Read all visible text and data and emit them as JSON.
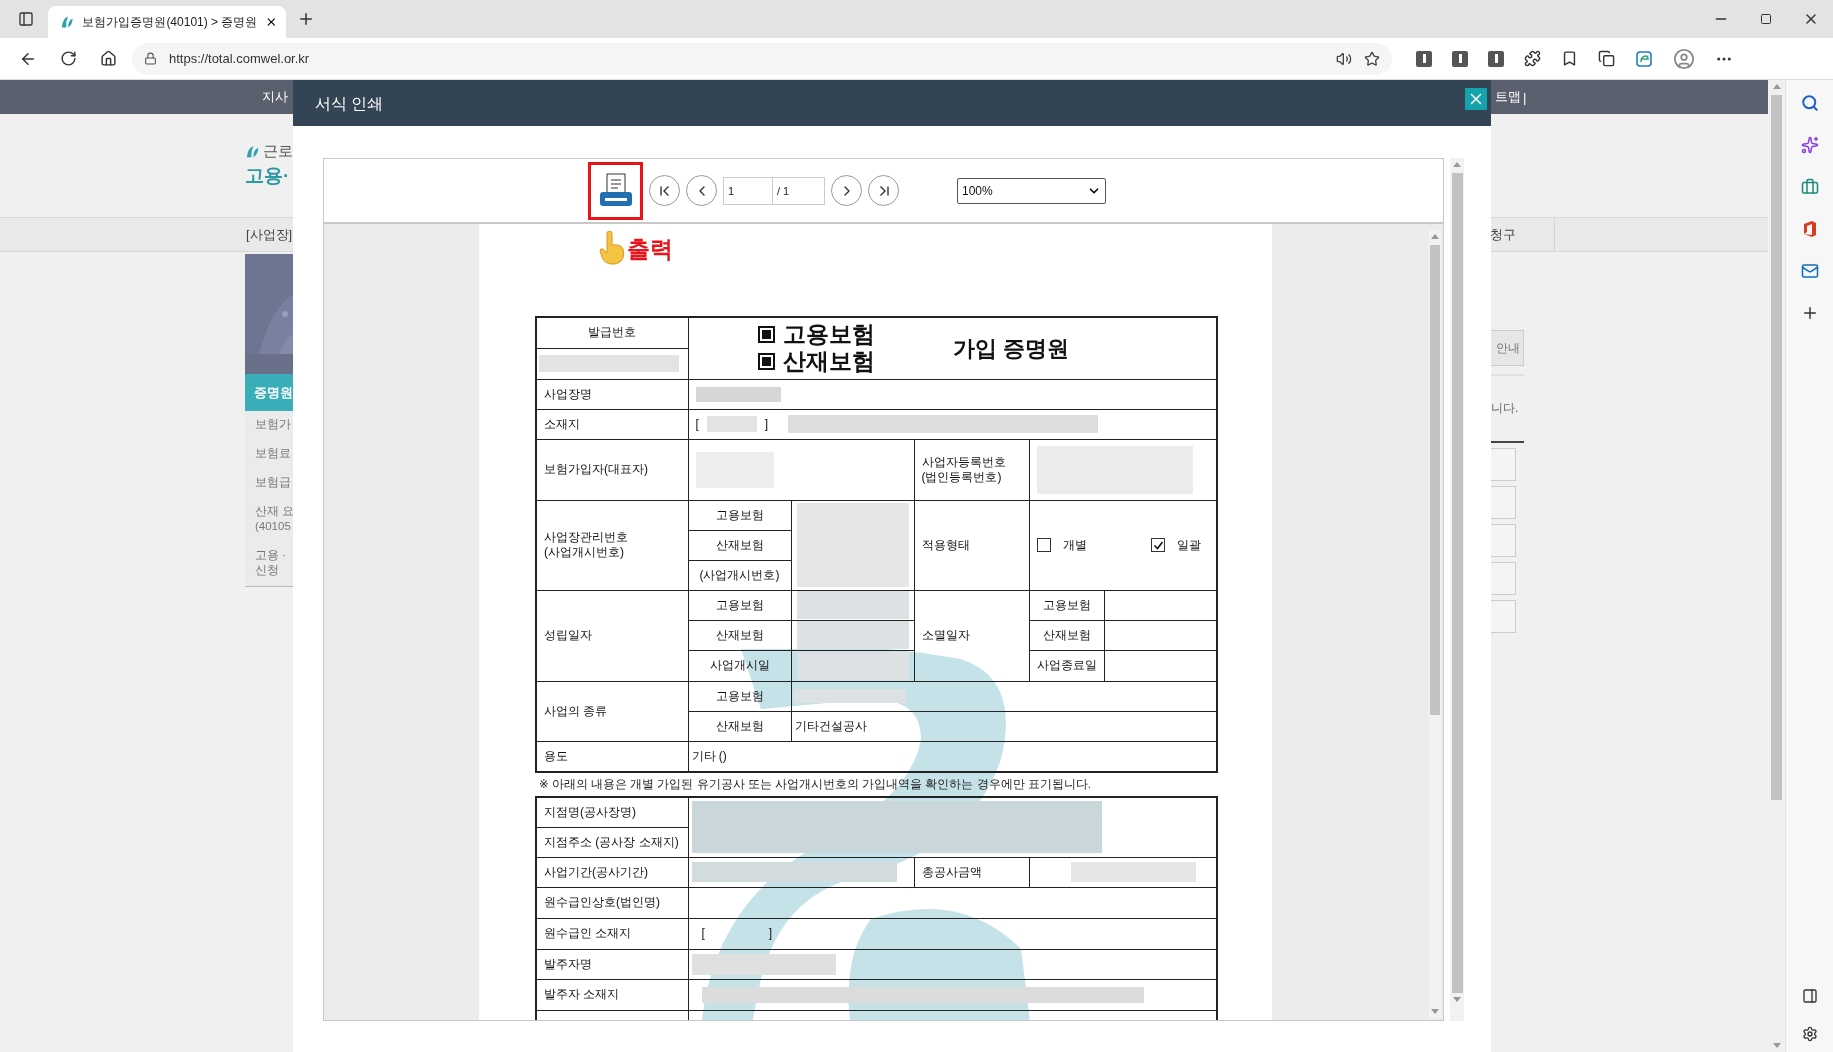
{
  "browser": {
    "tab_title": "보험가입증명원(40101) > 증명원",
    "url": "https://total.comwel.or.kr"
  },
  "site": {
    "nav_left": "지사",
    "nav_right": "트맵",
    "nav_divider": "|",
    "logo_lines": [
      "근로",
      "고용·"
    ],
    "breadcrumb": "[사업장]",
    "breadcrumb_right": "청구",
    "side_menu": {
      "title": "증명원",
      "items": [
        {
          "lines": [
            "보험가"
          ]
        },
        {
          "lines": [
            "보험료"
          ]
        },
        {
          "lines": [
            "보험급"
          ]
        },
        {
          "lines": [
            "산재 요",
            "(40105"
          ]
        },
        {
          "lines": [
            "고용 ·",
            "신청"
          ]
        }
      ]
    },
    "guide_button": "안내",
    "notice": "니다."
  },
  "modal": {
    "title": "서식 인쇄",
    "toolbar": {
      "page": "1",
      "page_total": "/ 1",
      "zoom": "100%"
    },
    "callout": "출력",
    "document": {
      "issue_label": "발급번호",
      "insurance_types": [
        {
          "label": "고용보험",
          "checked": true
        },
        {
          "label": "산재보험",
          "checked": true
        }
      ],
      "title": "가입 증명원",
      "business_name_label": "사업장명",
      "address_label": "소재지",
      "address_brackets": [
        "[",
        "]"
      ],
      "insured_label": "보험가입자(대표자)",
      "registration_label": [
        "사업자등록번호",
        "(법인등록번호)"
      ],
      "management_label": [
        "사업장관리번호",
        "(사업개시번호)"
      ],
      "management_sub": [
        "고용보험",
        "산재보험",
        "(사업개시번호)"
      ],
      "apply_type_label": "적용형태",
      "apply_options": [
        {
          "label": "개별",
          "checked": false
        },
        {
          "label": "일괄",
          "checked": true
        }
      ],
      "established_label": "성립일자",
      "established_sub": [
        "고용보험",
        "산재보험",
        "사업개시일"
      ],
      "closed_label": "소멸일자",
      "closed_sub": [
        "고용보험",
        "산재보험",
        "사업종료일"
      ],
      "business_type_label": "사업의 종류",
      "business_type_sub": [
        "고용보험",
        "산재보험"
      ],
      "business_type_value": "기타건설공사",
      "usage_label": "용도",
      "usage_value": "기타 ()",
      "note": "※ 아래의 내용은 개별 가입된 유기공사 또는 사업개시번호의 가입내역을 확인하는 경우에만 표기됩니다.",
      "branch_name_label": "지점명(공사장명)",
      "branch_address_label": "지점주소 (공사장 소재지)",
      "period_label": "사업기간(공사기간)",
      "total_amount_label": "총공사금액",
      "contractor_label": "원수급인상호(법인명)",
      "contractor_address_label": "원수급인 소재지",
      "contractor_brackets": [
        "[",
        "]"
      ],
      "orderer_label": "발주자명",
      "orderer_address_label": "발주자 소재지"
    }
  }
}
